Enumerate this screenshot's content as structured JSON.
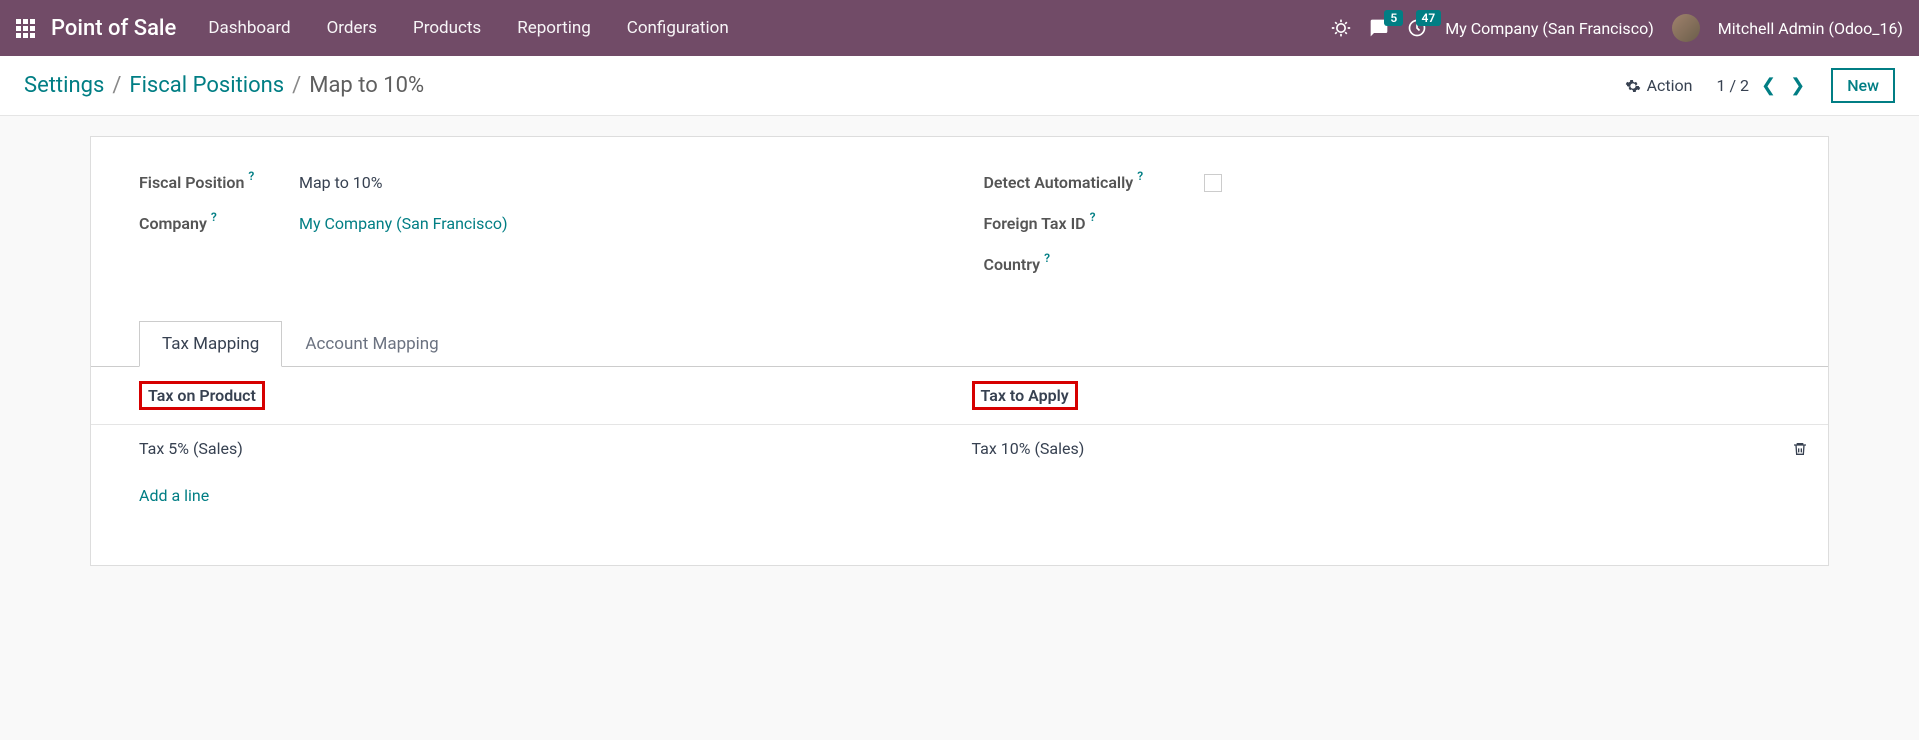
{
  "topbar": {
    "app_title": "Point of Sale",
    "nav_items": [
      "Dashboard",
      "Orders",
      "Products",
      "Reporting",
      "Configuration"
    ],
    "messages_badge": "5",
    "activities_badge": "47",
    "company": "My Company (San Francisco)",
    "user": "Mitchell Admin (Odoo_16)"
  },
  "breadcrumb": {
    "root": "Settings",
    "parent": "Fiscal Positions",
    "current": "Map to 10%"
  },
  "controls": {
    "action_label": "Action",
    "pager": "1 / 2",
    "new_label": "New"
  },
  "form": {
    "fiscal_position_label": "Fiscal Position",
    "fiscal_position_value": "Map to 10%",
    "company_label": "Company",
    "company_value": "My Company (San Francisco)",
    "detect_auto_label": "Detect Automatically",
    "foreign_tax_label": "Foreign Tax ID",
    "country_label": "Country"
  },
  "tabs": {
    "tax_mapping": "Tax Mapping",
    "account_mapping": "Account Mapping"
  },
  "table": {
    "header_tax_on_product": "Tax on Product",
    "header_tax_to_apply": "Tax to Apply",
    "rows": [
      {
        "tax_on_product": "Tax 5% (Sales)",
        "tax_to_apply": "Tax 10% (Sales)"
      }
    ],
    "add_line": "Add a line"
  }
}
